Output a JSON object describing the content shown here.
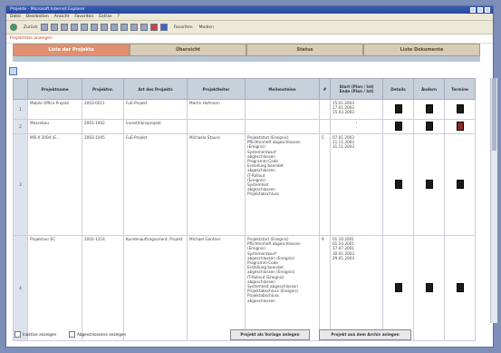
{
  "window": {
    "title": "Projekte - Microsoft Internet Explorer"
  },
  "menu": [
    "Datei",
    "Bearbeiten",
    "Ansicht",
    "Favoriten",
    "Extras",
    "?"
  ],
  "toolbar": {
    "back": "Zurück",
    "favorites": "Favoriten",
    "media": "Medien"
  },
  "address": "Projektliste anzeigen",
  "tabs": [
    "Liste der Projekte",
    "Übersicht",
    "Status",
    "Liste Dokumente"
  ],
  "table": {
    "headers": [
      "",
      "Projektname",
      "Projektnr.",
      "Art des Projekts",
      "Projektleiter",
      "Meilensteine",
      "#",
      "Start (Plan / Ist)\nEnde (Plan / Ist)",
      "Details",
      "Ändern",
      "Termine"
    ],
    "rows": [
      {
        "n": "1",
        "name": "Mobile Office Projekt",
        "nr": "2003-0011",
        "art": "FuE-Projekt",
        "leiter": "Martin Hofmann",
        "ms": "",
        "hash": "",
        "dates": "15.01.2003\n17.01.2003\n15.03.2003",
        "red": false
      },
      {
        "n": "2",
        "name": "Messebau",
        "nr": "2001-1402",
        "art": "Investitionsprojekt",
        "leiter": "",
        "ms": "",
        "hash": "",
        "dates": "-\n-",
        "red": true
      },
      {
        "n": "3",
        "name": "MIS II 2004 (E...",
        "nr": "2003-1045",
        "art": "FuE-Projekt",
        "leiter": "Michaela Stauss",
        "ms": "Projektstart (Ereignis)\nPflichtenheft abgeschlossen\n(Ereignis)\nSystementwurf\nabgeschlossen\nProgramm-Code\nErstellung beendet\nabgeschlossen\nIT-Rollout\n(Ereignis)\nSystemtest\nabgeschlossen\nProjektabschluss",
        "hash": "5",
        "dates": "07.01.2003\n11.11.2003\n31.11.2003",
        "red": false
      },
      {
        "n": "4",
        "name": "Projektvor EC",
        "nr": "2002-1214",
        "art": "Kundenauftragsorient. Projekt",
        "leiter": "Michael Gantner",
        "ms": "Projektstart (Ereignis)\nPflichtenheft abgeschlossen\n(Ereignis)\nSystementwurf\nabgeschlossen (Ereignis)\nProgramm-Code\nErstellung beendet\nabgeschlossen (Ereignis)\nIT-Rollout (Ereignis)\nabgeschlossen\nSystemtest abgeschlossen\nProjektabschluss (Ereignis)\nProjektabschluss\nabgeschlossen",
        "hash": "9",
        "dates": "01.10.2001\n01.10.2001\n17.07.2001\n30.01.2003\n29.01.2003",
        "red": false
      }
    ]
  },
  "footer": {
    "check1": "Inaktive anzeigen",
    "check2": "Abgeschlossene anzeigen",
    "btn1": "Projekt als Vorlage anlegen",
    "btn2": "Projekt aus dem Archiv anlegen"
  }
}
